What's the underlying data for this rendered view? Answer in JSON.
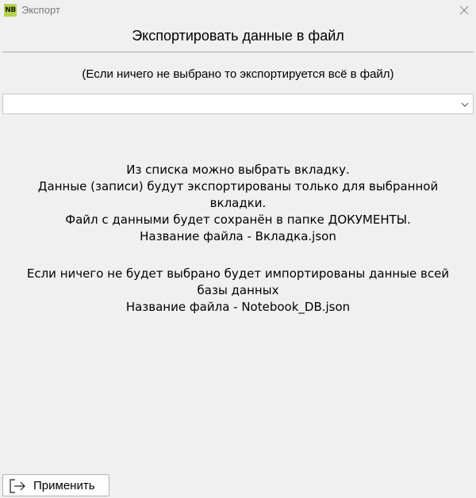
{
  "window": {
    "app_icon_text": "NB",
    "title": "Экспорт",
    "close_icon": "close-icon"
  },
  "header": {
    "title": "Экспортировать данные в файл"
  },
  "hint": "(Если ничего не выбрано то экспортируется всё в файл)",
  "tab_select": {
    "value": "",
    "icon": "chevron-down-icon"
  },
  "info": {
    "lines": [
      "Из списка можно выбрать вкладку.",
      "Данные (записи) будут экспортированы только для выбранной вкладки.",
      "Файл с данными будет сохранён в папке ДОКУМЕНТЫ.",
      "Название файла - Вкладка.json",
      "Если ничего не будет выбрано будет импортированы данные всей базы данных",
      "Название файла - Notebook_DB.json"
    ]
  },
  "footer": {
    "apply_label": "Применить",
    "apply_icon": "export-icon"
  },
  "colors": {
    "background": "#f0f0f0",
    "app_icon_bg": "#b7d34a",
    "title_text": "#7a7a7a"
  }
}
